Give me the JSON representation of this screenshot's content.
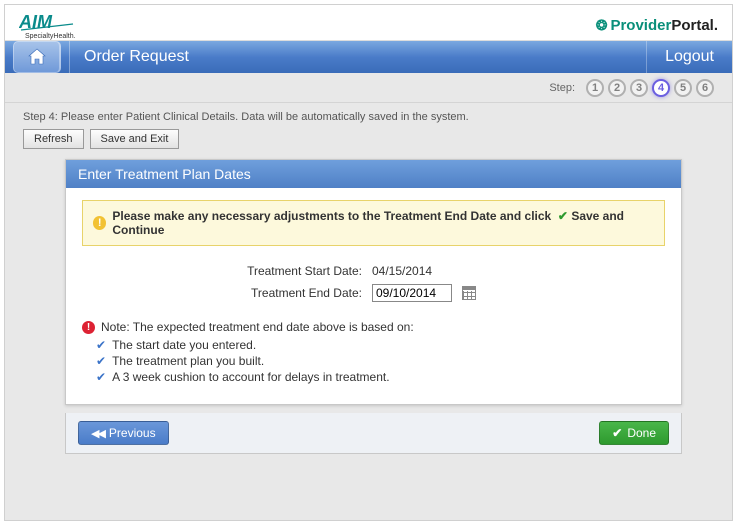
{
  "brand": {
    "aim_top": "AIM",
    "aim_sub": "SpecialtyHealth.",
    "provider": "Provider",
    "portal": "Portal",
    "dot": "."
  },
  "nav": {
    "title": "Order Request",
    "logout": "Logout"
  },
  "steps": {
    "label": "Step:",
    "items": [
      "1",
      "2",
      "3",
      "4",
      "5",
      "6"
    ],
    "active_index": 3
  },
  "subtext": "Step 4: Please enter Patient Clinical Details. Data will be automatically saved in the system.",
  "grey_buttons": {
    "refresh": "Refresh",
    "save_exit": "Save and Exit"
  },
  "card": {
    "header": "Enter Treatment Plan Dates",
    "alert_pre": "Please make any necessary adjustments to the Treatment End Date and click",
    "alert_post": "Save and Continue",
    "start_label": "Treatment Start Date:",
    "start_value": "04/15/2014",
    "end_label": "Treatment End Date:",
    "end_value": "09/10/2014",
    "note_header": "Note: The expected treatment end date above is based on:",
    "note_items": [
      "The start date you entered.",
      "The treatment plan you built.",
      "A 3 week cushion to account for delays in treatment."
    ]
  },
  "footer": {
    "previous": "Previous",
    "done": "Done"
  }
}
